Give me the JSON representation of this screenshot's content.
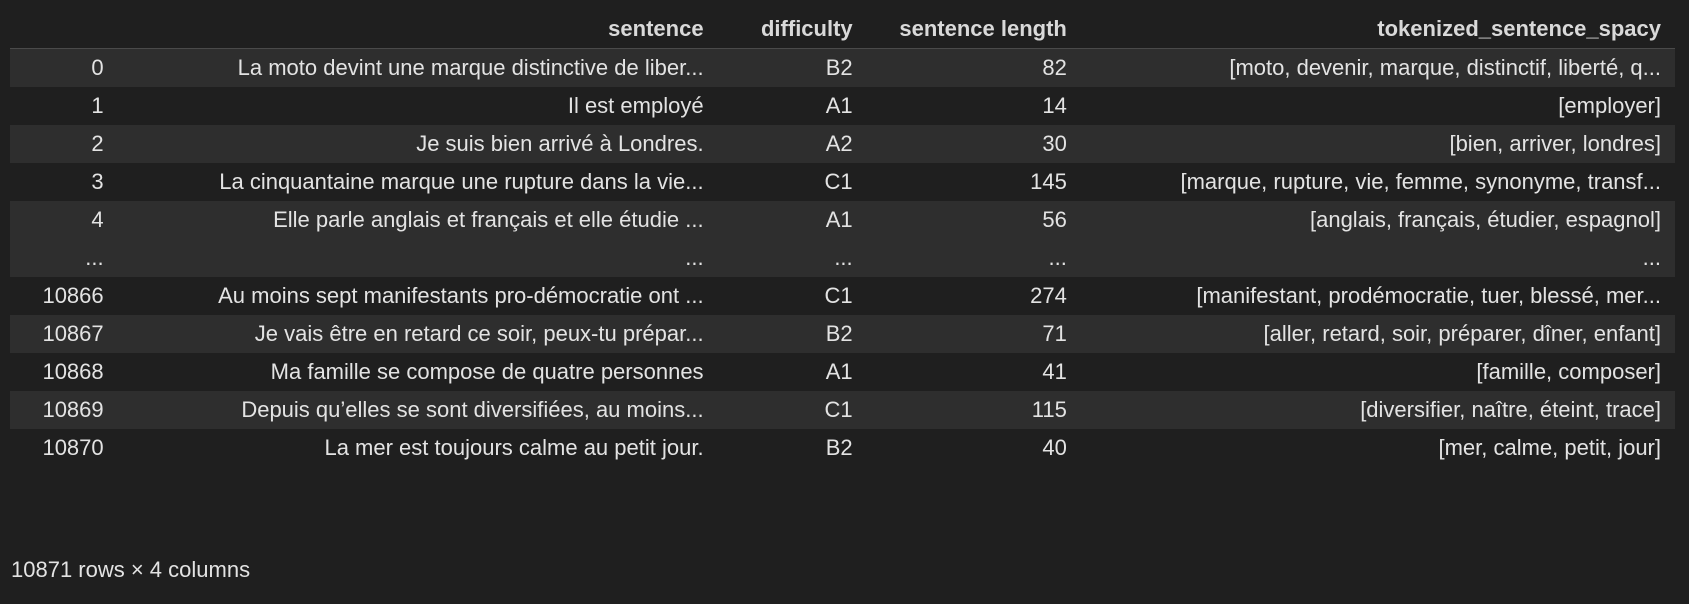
{
  "dataframe": {
    "columns": [
      "",
      "sentence",
      "difficulty",
      "sentence length",
      "tokenized_sentence_spacy"
    ],
    "rows": [
      [
        "0",
        "La moto devint une marque distinctive de liber...",
        "B2",
        "82",
        "[moto, devenir, marque, distinctif, liberté, q..."
      ],
      [
        "1",
        "Il est employé",
        "A1",
        "14",
        "[employer]"
      ],
      [
        "2",
        "Je suis bien arrivé à Londres.",
        "A2",
        "30",
        "[bien, arriver, londres]"
      ],
      [
        "3",
        "La cinquantaine marque une rupture dans la vie...",
        "C1",
        "145",
        "[marque, rupture, vie, femme, synonyme, transf..."
      ],
      [
        "4",
        "Elle parle anglais et français et elle étudie ...",
        "A1",
        "56",
        "[anglais, français, étudier, espagnol]"
      ],
      [
        "...",
        "...",
        "...",
        "...",
        "..."
      ],
      [
        "10866",
        "Au moins sept manifestants pro-démocratie ont ...",
        "C1",
        "274",
        "[manifestant, prodémocratie, tuer, blessé, mer..."
      ],
      [
        "10867",
        "Je vais être en retard ce soir, peux-tu prépar...",
        "B2",
        "71",
        "[aller, retard, soir, préparer, dîner, enfant]"
      ],
      [
        "10868",
        "Ma famille se compose de quatre personnes",
        "A1",
        "41",
        "[famille, composer]"
      ],
      [
        "10869",
        "Depuis qu’elles se sont diversifiées, au moins...",
        "C1",
        "115",
        "[diversifier, naître, éteint, trace]"
      ],
      [
        "10870",
        "La mer est toujours calme au petit jour.",
        "B2",
        "40",
        "[mer, calme, petit, jour]"
      ]
    ],
    "summary": "10871 rows × 4 columns"
  },
  "colors": {
    "background": "#1f1f1f",
    "stripe": "#2e2e2e",
    "text": "#e3e3e3"
  }
}
